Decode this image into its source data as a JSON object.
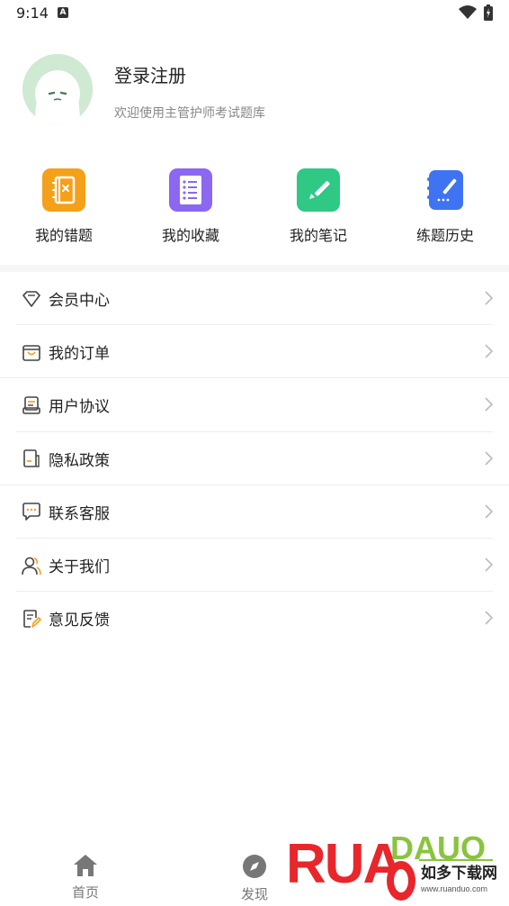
{
  "status": {
    "time": "9:14"
  },
  "profile": {
    "title": "登录注册",
    "subtitle": "欢迎使用主管护师考试题库"
  },
  "quick_actions": [
    {
      "label": "我的错题",
      "icon": "error-book-icon",
      "color": "#f5a019"
    },
    {
      "label": "我的收藏",
      "icon": "favorites-list-icon",
      "color": "#8a68f0"
    },
    {
      "label": "我的笔记",
      "icon": "note-pen-icon",
      "color": "#2fc985"
    },
    {
      "label": "练题历史",
      "icon": "history-notebook-icon",
      "color": "#3e74f2"
    }
  ],
  "menu": [
    {
      "label": "会员中心",
      "icon": "diamond-icon"
    },
    {
      "label": "我的订单",
      "icon": "shopping-bag-icon"
    },
    {
      "label": "用户协议",
      "icon": "agreement-icon"
    },
    {
      "label": "隐私政策",
      "icon": "privacy-doc-icon"
    },
    {
      "label": "联系客服",
      "icon": "chat-bubble-icon"
    },
    {
      "label": "关于我们",
      "icon": "users-icon"
    },
    {
      "label": "意见反馈",
      "icon": "feedback-edit-icon"
    }
  ],
  "tabbar": {
    "home": "首页",
    "discover": "发现"
  },
  "watermark": {
    "brand": "RUANDUO",
    "cn": "如多下载网",
    "url": "www.ruanduo.com"
  }
}
